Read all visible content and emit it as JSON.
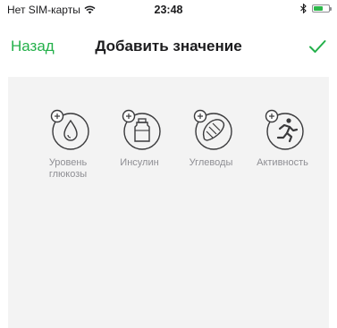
{
  "status_bar": {
    "carrier": "Нет SIM-карты",
    "time": "23:48",
    "battery_level": 0.65
  },
  "nav": {
    "back_label": "Назад",
    "title": "Добавить значение"
  },
  "colors": {
    "accent": "#23b04a",
    "icon_stroke": "#3a3a3c",
    "label": "#8e8e93",
    "panel_bg": "#f3f3f3"
  },
  "options": [
    {
      "label": "Уровень глюкозы",
      "icon": "glucose-drop-icon"
    },
    {
      "label": "Инсулин",
      "icon": "insulin-vial-icon"
    },
    {
      "label": "Углеводы",
      "icon": "carbs-bread-icon"
    },
    {
      "label": "Активность",
      "icon": "activity-runner-icon"
    }
  ]
}
